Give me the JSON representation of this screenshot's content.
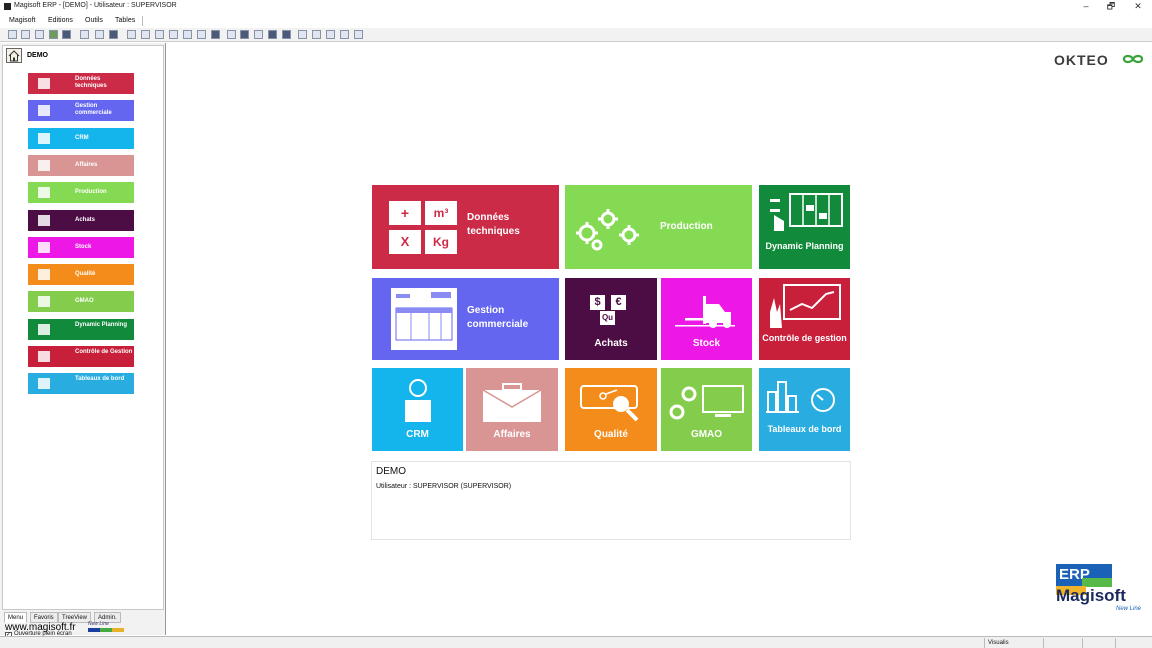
{
  "window": {
    "title": "Magisoft ERP - [DEMO] - Utilisateur : SUPERVISOR",
    "minimize": "–",
    "restore": "🗗",
    "close": "✕"
  },
  "menu": [
    "Magisoft",
    "Editions",
    "Outils",
    "Tables"
  ],
  "sidebar": {
    "header": "DEMO",
    "items": [
      {
        "label": "Données techniques",
        "color": "#cc2b48",
        "icon": "calc-icon"
      },
      {
        "label": "Gestion commerciale",
        "color": "#6466f0",
        "icon": "invoice-icon"
      },
      {
        "label": "CRM",
        "color": "#14b4ec",
        "icon": "person-icon"
      },
      {
        "label": "Affaires",
        "color": "#d99494",
        "icon": "briefcase-icon"
      },
      {
        "label": "Production",
        "color": "#84da52",
        "icon": "gears-icon"
      },
      {
        "label": "Achats",
        "color": "#4c0d44",
        "icon": "currency-icon"
      },
      {
        "label": "Stock",
        "color": "#ee18e6",
        "icon": "forklift-icon"
      },
      {
        "label": "Qualité",
        "color": "#f48c1c",
        "icon": "magnifier-icon"
      },
      {
        "label": "GMAO",
        "color": "#84cc4c",
        "icon": "gear-monitor-icon"
      },
      {
        "label": "Dynamic Planning",
        "color": "#118a3b",
        "icon": "planning-icon"
      },
      {
        "label": "Contrôle de Gestion",
        "color": "#c81f3a",
        "icon": "chart-icon"
      },
      {
        "label": "Tableaux de bord",
        "color": "#29ade0",
        "icon": "dashboard-icon"
      }
    ],
    "tabs": [
      "Menu",
      "Favoris",
      "TreeView",
      "Admin."
    ],
    "fullscreen_label": "Ouverture plein écran",
    "fullscreen_checked": true,
    "website": "www.magisoft.fr",
    "website_badge": "New Line"
  },
  "tiles": {
    "donnees": "Données techniques",
    "donnees_keys": [
      "+",
      "m³",
      "X",
      "Kg"
    ],
    "production": "Production",
    "planning": "Dynamic Planning",
    "gestion": "Gestion commerciale",
    "achats": "Achats",
    "stock": "Stock",
    "controle": "Contrôle de gestion",
    "crm": "CRM",
    "affaires": "Affaires",
    "qualite": "Qualité",
    "gmao": "GMAO",
    "tableaux": "Tableaux de bord"
  },
  "info": {
    "database": "DEMO",
    "user": "Utilisateur : SUPERVISOR (SUPERVISOR)"
  },
  "branding": {
    "okteo": "OKTEO",
    "erp_top": "ERP",
    "erp_name": "Magisoft",
    "erp_badge": "New Line"
  },
  "status": {
    "mode": "Visualis"
  }
}
